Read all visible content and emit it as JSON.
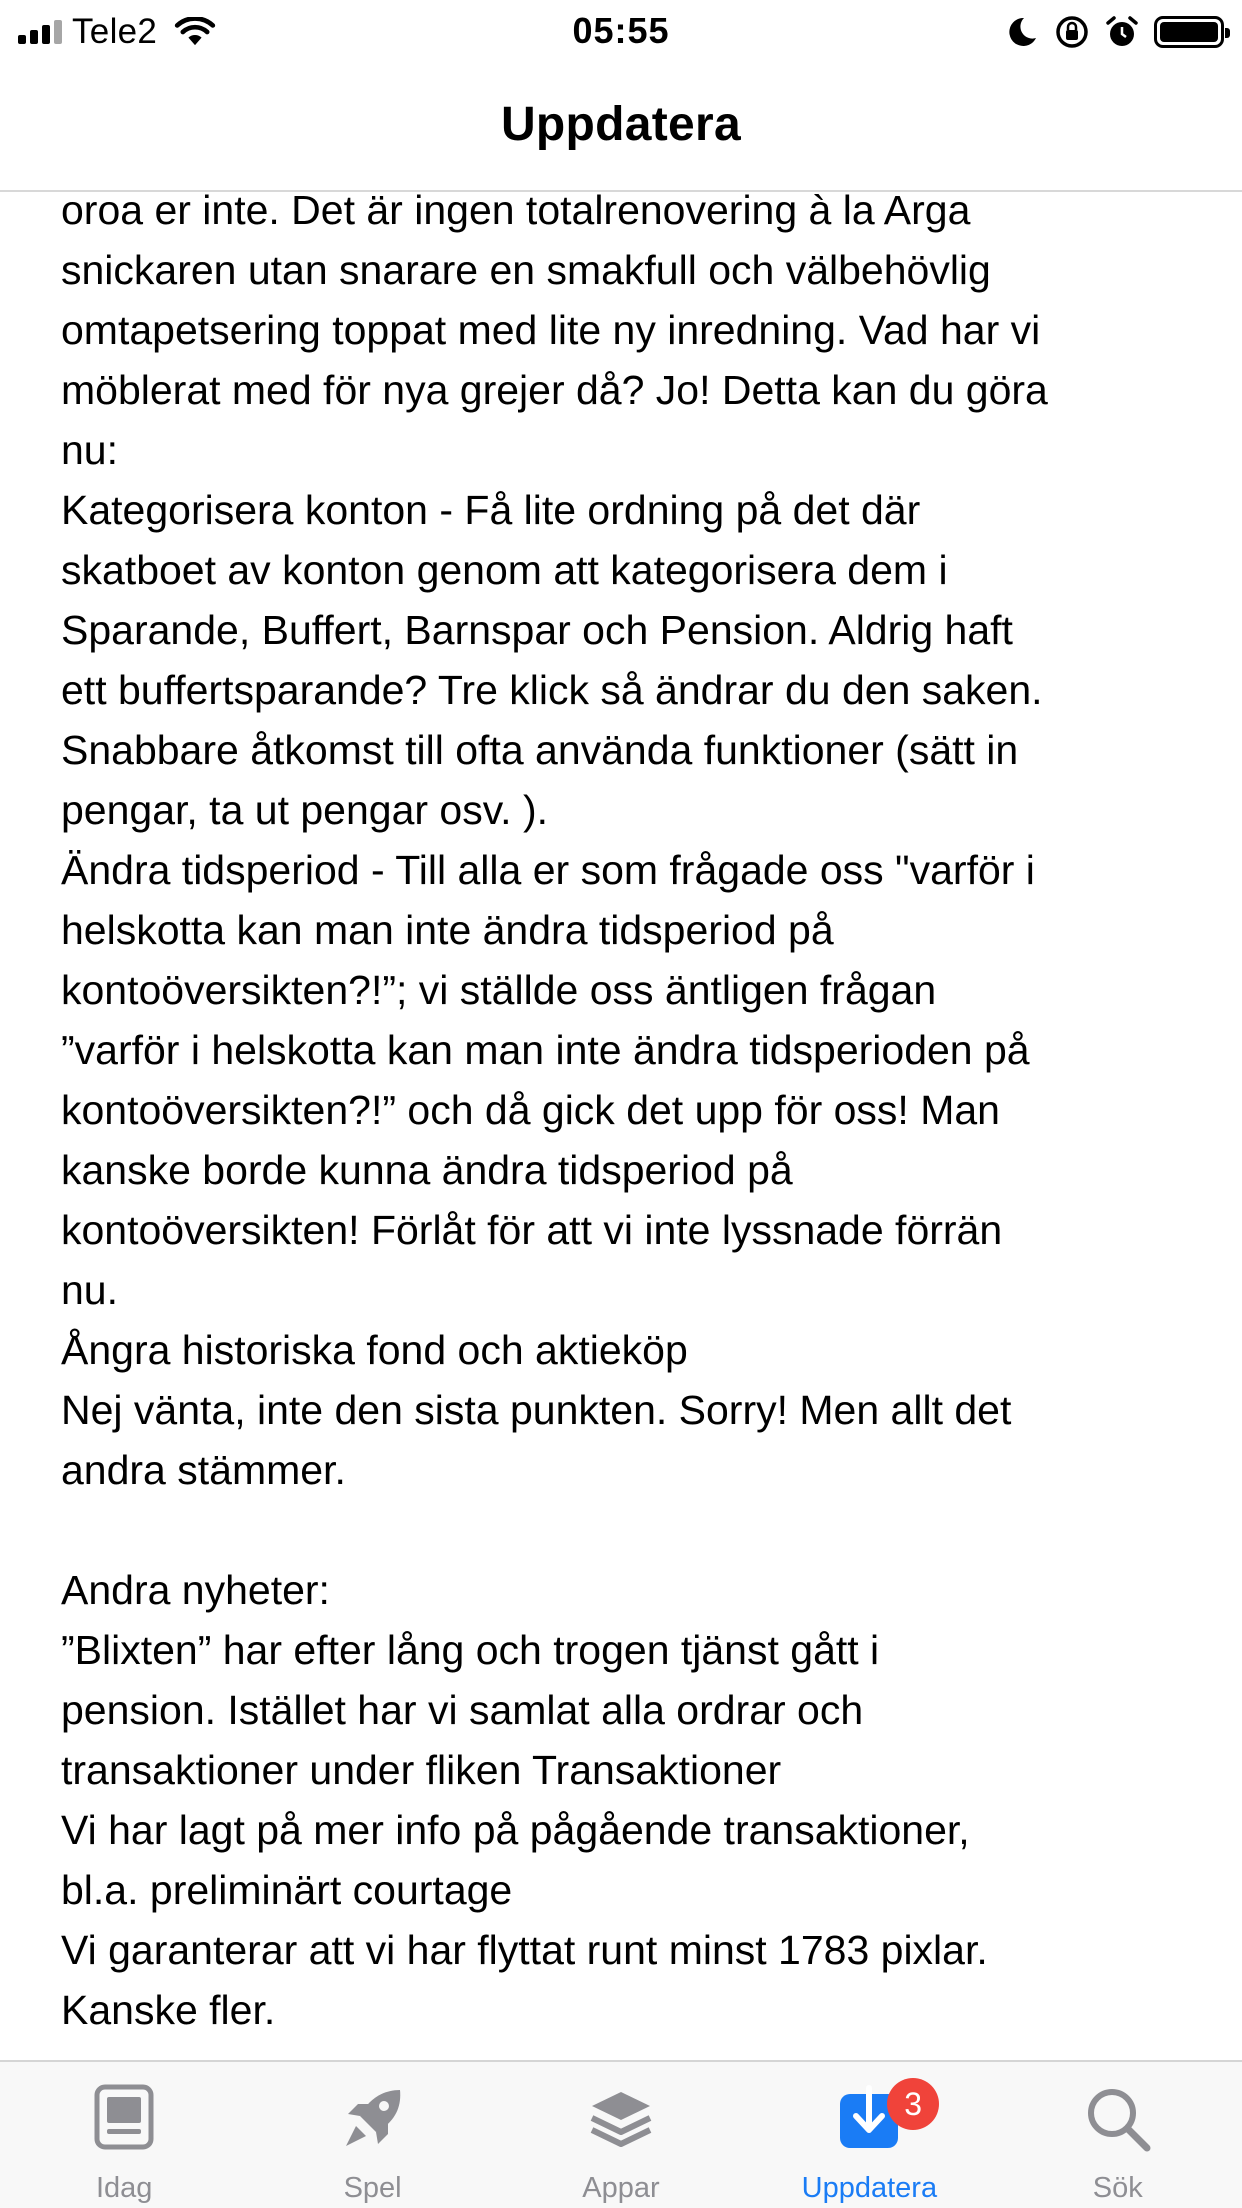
{
  "status": {
    "carrier": "Tele2",
    "time": "05:55",
    "battery_level": 1.0
  },
  "header": {
    "title": "Uppdatera"
  },
  "release_notes": {
    "lines": [
      "oroa er inte. Det är ingen totalrenovering à la Arga",
      "snickaren utan snarare en smakfull och välbehövlig",
      "omtapetsering toppat med lite ny inredning. Vad har vi",
      "möblerat med för nya grejer då? Jo! Detta kan du göra",
      "nu:",
      "Kategorisera konton - Få lite ordning på det där",
      "skatboet av konton genom att kategorisera dem i",
      "Sparande, Buffert, Barnspar och Pension. Aldrig haft",
      "ett buffertsparande? Tre klick så ändrar du den saken.",
      "Snabbare åtkomst till ofta använda funktioner (sätt in",
      "pengar, ta ut pengar osv. ).",
      "Ändra tidsperiod - Till alla er som frågade oss \"varför i",
      "helskotta kan man inte ändra tidsperiod på",
      "kontoöversikten?!”; vi ställde oss äntligen frågan",
      "”varför i helskotta kan man inte ändra tidsperioden på",
      "kontoöversikten?!” och då gick det upp för oss! Man",
      "kanske borde kunna ändra tidsperiod på",
      "kontoöversikten! Förlåt för att vi inte lyssnade förrän",
      "nu.",
      "Ångra historiska fond och aktieköp",
      "Nej vänta, inte den sista punkten. Sorry! Men allt det",
      "andra stämmer.",
      "",
      "Andra nyheter:",
      "”Blixten” har efter lång och trogen tjänst gått i",
      "pension. Istället har vi samlat alla ordrar och",
      "transaktioner under fliken Transaktioner",
      "Vi har lagt på mer info på pågående transaktioner,",
      "bl.a. preliminärt courtage",
      "Vi garanterar att vi har flyttat runt minst 1783 pixlar.",
      "Kanske fler."
    ]
  },
  "tab_bar": {
    "tabs": [
      {
        "label": "Idag",
        "icon": "today-icon"
      },
      {
        "label": "Spel",
        "icon": "rocket-icon"
      },
      {
        "label": "Appar",
        "icon": "apps-stack-icon"
      },
      {
        "label": "Uppdatera",
        "icon": "download-icon",
        "active": true,
        "badge": "3"
      },
      {
        "label": "Sök",
        "icon": "search-icon"
      }
    ]
  },
  "colors": {
    "accent": "#1a7cf5",
    "inactive": "#8e8e93",
    "badge": "#f0433a"
  }
}
